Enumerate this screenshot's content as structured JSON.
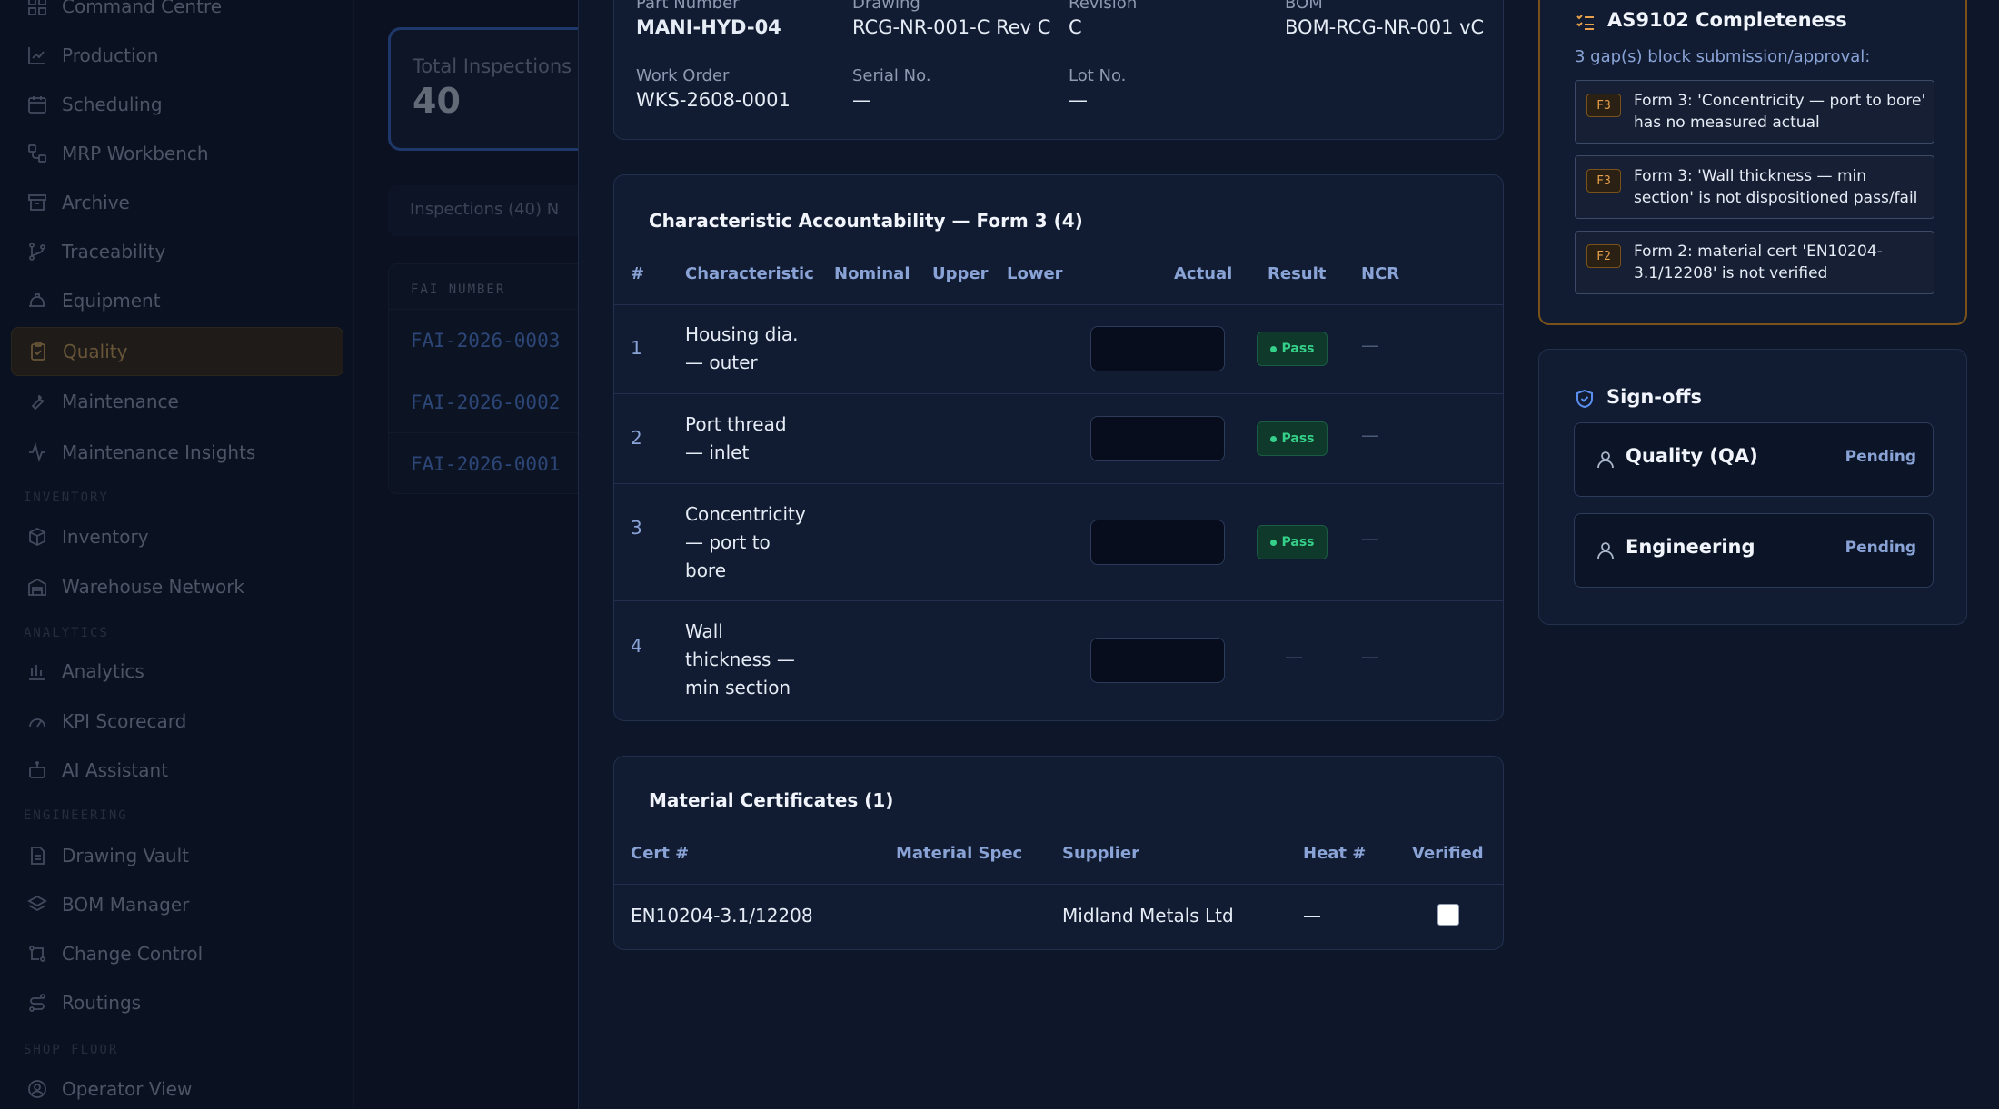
{
  "sidebar": {
    "items": [
      {
        "label": "Command Centre",
        "icon": "dashboard-icon"
      },
      {
        "label": "Production",
        "icon": "chart-icon"
      },
      {
        "label": "Scheduling",
        "icon": "calendar-icon"
      },
      {
        "label": "MRP Workbench",
        "icon": "workflow-icon"
      },
      {
        "label": "Archive",
        "icon": "archive-icon"
      },
      {
        "label": "Traceability",
        "icon": "git-branch-icon"
      },
      {
        "label": "Equipment",
        "icon": "hard-hat-icon"
      },
      {
        "label": "Quality",
        "icon": "clipboard-check-icon"
      },
      {
        "label": "Maintenance",
        "icon": "wrench-icon"
      },
      {
        "label": "Maintenance Insights",
        "icon": "activity-icon"
      },
      {
        "label": "Inventory",
        "icon": "package-icon"
      },
      {
        "label": "Warehouse Network",
        "icon": "warehouse-icon"
      },
      {
        "label": "Analytics",
        "icon": "bar-chart-icon"
      },
      {
        "label": "KPI Scorecard",
        "icon": "gauge-icon"
      },
      {
        "label": "AI Assistant",
        "icon": "bot-icon"
      },
      {
        "label": "Drawing Vault",
        "icon": "file-icon"
      },
      {
        "label": "BOM Manager",
        "icon": "layers-icon"
      },
      {
        "label": "Change Control",
        "icon": "git-compare-icon"
      },
      {
        "label": "Routings",
        "icon": "route-icon"
      },
      {
        "label": "Operator View",
        "icon": "user-circle-icon"
      }
    ],
    "sections": {
      "inventory": "INVENTORY",
      "analytics": "ANALYTICS",
      "engineering": "ENGINEERING",
      "shop_floor": "SHOP FLOOR"
    }
  },
  "background": {
    "stat_label": "Total Inspections",
    "stat_value": "40",
    "tabs": "Inspections (40)    N",
    "table_header": "FAI NUMBER",
    "rows": [
      "FAI-2026-0003",
      "FAI-2026-0002",
      "FAI-2026-0001"
    ]
  },
  "header": {
    "part_number_label": "Part Number",
    "part_number": "MANI-HYD-04",
    "drawing_label": "Drawing",
    "drawing": "RCG-NR-001-C Rev C",
    "revision_label": "Revision",
    "revision": "C",
    "bom_label": "BOM",
    "bom": "BOM-RCG-NR-001 vC",
    "work_order_label": "Work Order",
    "work_order": "WKS-2608-0001",
    "serial_label": "Serial No.",
    "serial": "—",
    "lot_label": "Lot No.",
    "lot": "—"
  },
  "characteristics": {
    "title": "Characteristic Accountability — Form 3 (4)",
    "columns": [
      "#",
      "Characteristic",
      "Nominal",
      "Upper",
      "Lower",
      "Actual",
      "Result",
      "NCR"
    ],
    "rows": [
      {
        "idx": "1",
        "name_lines": [
          "Housing dia.",
          "— outer"
        ],
        "result": "Pass",
        "ncr": "—"
      },
      {
        "idx": "2",
        "name_lines": [
          "Port thread",
          "— inlet"
        ],
        "result": "Pass",
        "ncr": "—"
      },
      {
        "idx": "3",
        "name_lines": [
          "Concentricity",
          "— port to",
          "bore"
        ],
        "result": "Pass",
        "ncr": "—"
      },
      {
        "idx": "4",
        "name_lines": [
          "Wall",
          "thickness —",
          "min section"
        ],
        "result": "—",
        "ncr": "—"
      }
    ]
  },
  "certificates": {
    "title": "Material Certificates (1)",
    "columns": [
      "Cert #",
      "Material Spec",
      "Supplier",
      "Heat #",
      "Verified"
    ],
    "rows": [
      {
        "cert": "EN10204-3.1/12208",
        "spec": "",
        "supplier": "Midland Metals Ltd",
        "heat": "—",
        "verified": false
      }
    ]
  },
  "as9102": {
    "title": "AS9102 Completeness",
    "subtitle": "3 gap(s) block submission/approval:",
    "accent": "#e8a04a",
    "gaps": [
      {
        "tag": "F3",
        "text": "Form 3: 'Concentricity — port to bore' has no measured actual"
      },
      {
        "tag": "F3",
        "text": "Form 3: 'Wall thickness — min section' is not dispositioned pass/fail"
      },
      {
        "tag": "F2",
        "text": "Form 2: material cert 'EN10204-3.1/12208' is not verified"
      }
    ]
  },
  "signoffs": {
    "title": "Sign-offs",
    "items": [
      {
        "name": "Quality (QA)",
        "status": "Pending"
      },
      {
        "name": "Engineering",
        "status": "Pending"
      }
    ]
  }
}
